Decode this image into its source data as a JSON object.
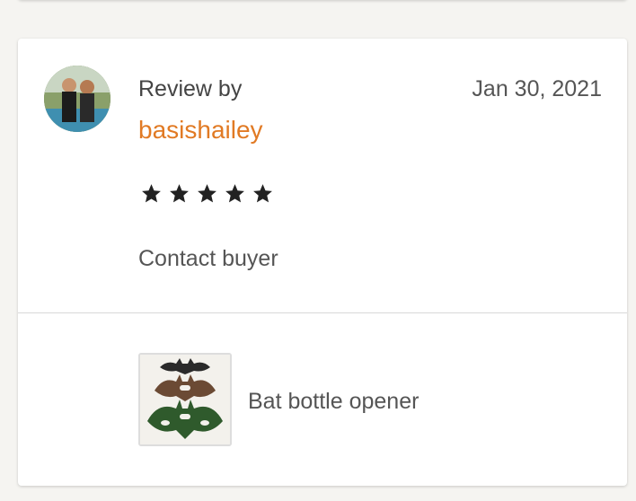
{
  "review": {
    "label": "Review by",
    "username": "basishailey",
    "date": "Jan 30, 2021",
    "rating": 5,
    "contact_label": "Contact buyer"
  },
  "product": {
    "name": "Bat bottle opener"
  },
  "colors": {
    "accent": "#e17a24",
    "star": "#222222"
  }
}
